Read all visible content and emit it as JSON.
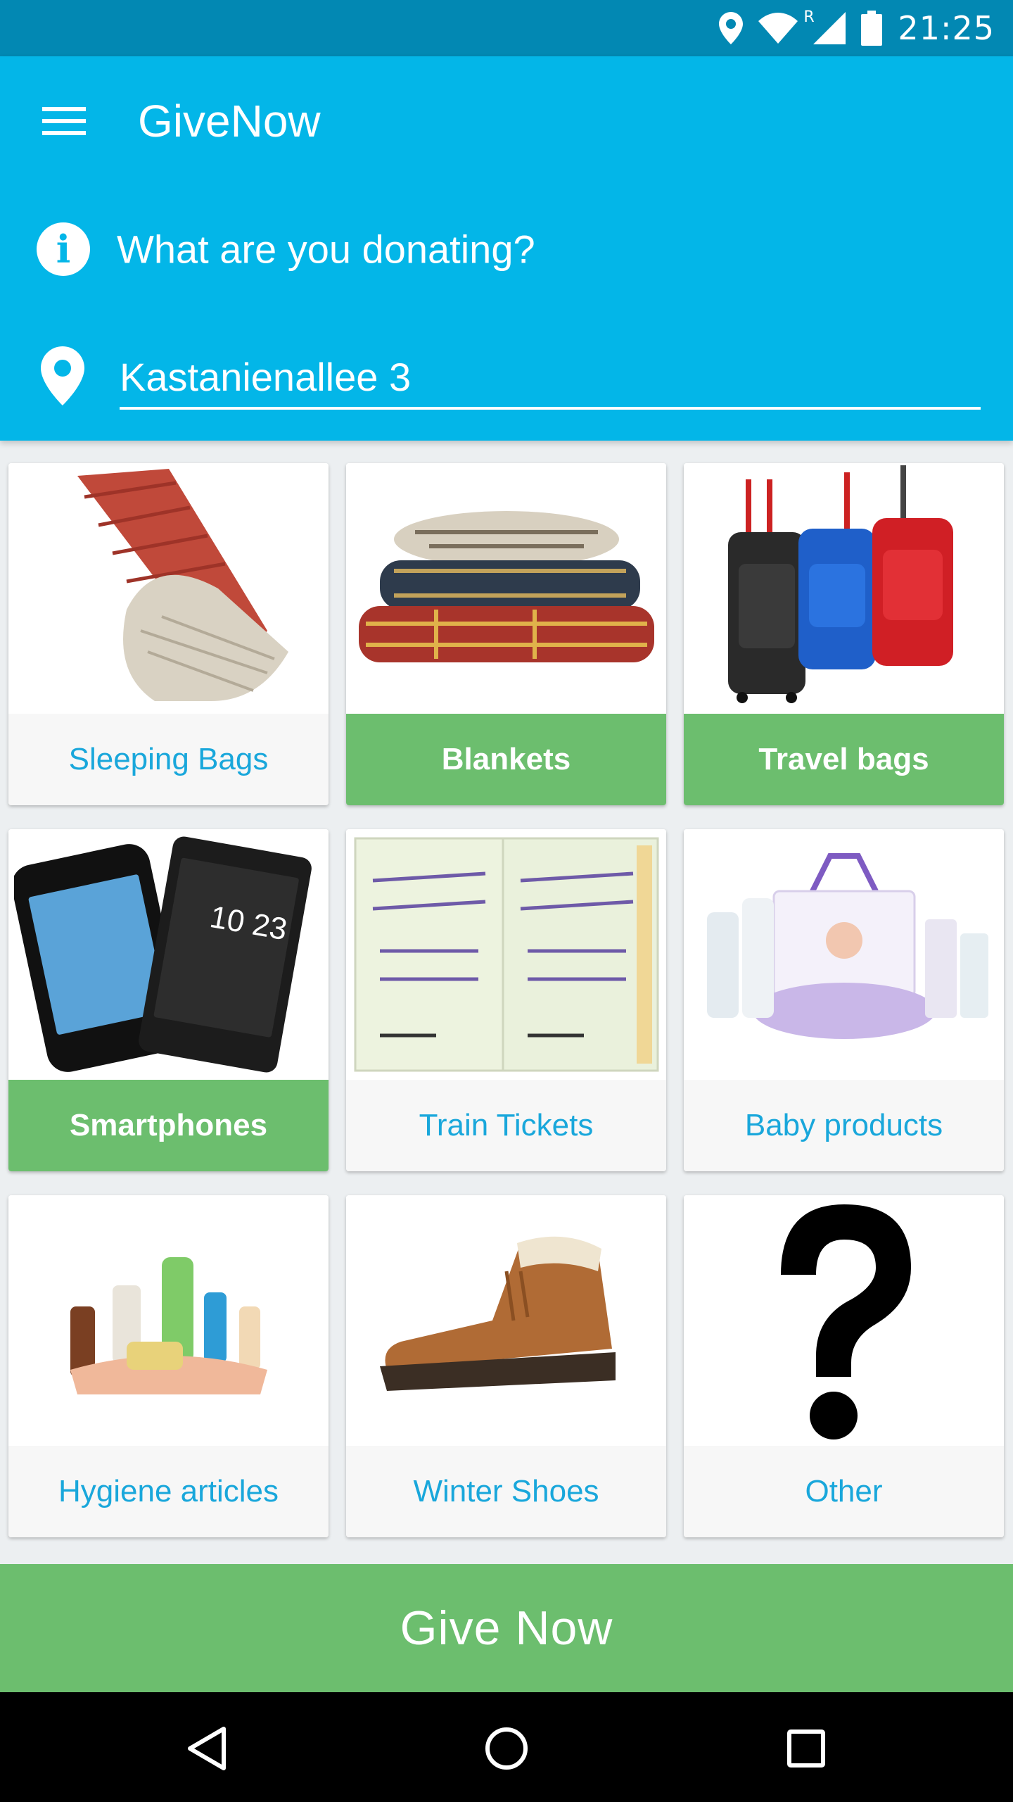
{
  "status_bar": {
    "time": "21:25",
    "roaming_indicator": "R",
    "icons": [
      "location-icon",
      "wifi-icon",
      "cell-signal-icon",
      "battery-icon"
    ]
  },
  "app_bar": {
    "title": "GiveNow",
    "menu_icon": "hamburger-menu-icon"
  },
  "prompt": {
    "icon": "info-icon",
    "text": "What are you donating?"
  },
  "location": {
    "icon": "location-pin-icon",
    "value": "Kastanienallee 3"
  },
  "categories": [
    {
      "label": "Sleeping Bags",
      "selected": false,
      "image": "sleeping-bag-image"
    },
    {
      "label": "Blankets",
      "selected": true,
      "image": "blankets-image"
    },
    {
      "label": "Travel bags",
      "selected": true,
      "image": "travel-bags-image"
    },
    {
      "label": "Smartphones",
      "selected": true,
      "image": "smartphones-image"
    },
    {
      "label": "Train Tickets",
      "selected": false,
      "image": "train-tickets-image"
    },
    {
      "label": "Baby products",
      "selected": false,
      "image": "baby-products-image"
    },
    {
      "label": "Hygiene articles",
      "selected": false,
      "image": "hygiene-articles-image"
    },
    {
      "label": "Winter Shoes",
      "selected": false,
      "image": "winter-shoes-image"
    },
    {
      "label": "Other",
      "selected": false,
      "image": "question-mark-image"
    }
  ],
  "give_button": {
    "label": "Give Now"
  },
  "nav_bar": {
    "buttons": [
      "back-icon",
      "home-icon",
      "recents-icon"
    ]
  },
  "colors": {
    "status_bar": "#0288B3",
    "app_bar": "#03B6E8",
    "selected": "#6CBE6E",
    "label_text": "#19A7DB",
    "background": "#ECEFF1"
  }
}
